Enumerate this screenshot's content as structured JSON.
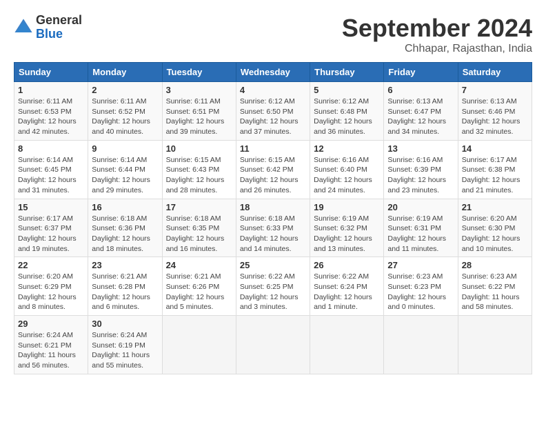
{
  "header": {
    "logo_general": "General",
    "logo_blue": "Blue",
    "month_title": "September 2024",
    "location": "Chhapar, Rajasthan, India"
  },
  "columns": [
    "Sunday",
    "Monday",
    "Tuesday",
    "Wednesday",
    "Thursday",
    "Friday",
    "Saturday"
  ],
  "weeks": [
    [
      {
        "day": "1",
        "info": "Sunrise: 6:11 AM\nSunset: 6:53 PM\nDaylight: 12 hours\nand 42 minutes."
      },
      {
        "day": "2",
        "info": "Sunrise: 6:11 AM\nSunset: 6:52 PM\nDaylight: 12 hours\nand 40 minutes."
      },
      {
        "day": "3",
        "info": "Sunrise: 6:11 AM\nSunset: 6:51 PM\nDaylight: 12 hours\nand 39 minutes."
      },
      {
        "day": "4",
        "info": "Sunrise: 6:12 AM\nSunset: 6:50 PM\nDaylight: 12 hours\nand 37 minutes."
      },
      {
        "day": "5",
        "info": "Sunrise: 6:12 AM\nSunset: 6:48 PM\nDaylight: 12 hours\nand 36 minutes."
      },
      {
        "day": "6",
        "info": "Sunrise: 6:13 AM\nSunset: 6:47 PM\nDaylight: 12 hours\nand 34 minutes."
      },
      {
        "day": "7",
        "info": "Sunrise: 6:13 AM\nSunset: 6:46 PM\nDaylight: 12 hours\nand 32 minutes."
      }
    ],
    [
      {
        "day": "8",
        "info": "Sunrise: 6:14 AM\nSunset: 6:45 PM\nDaylight: 12 hours\nand 31 minutes."
      },
      {
        "day": "9",
        "info": "Sunrise: 6:14 AM\nSunset: 6:44 PM\nDaylight: 12 hours\nand 29 minutes."
      },
      {
        "day": "10",
        "info": "Sunrise: 6:15 AM\nSunset: 6:43 PM\nDaylight: 12 hours\nand 28 minutes."
      },
      {
        "day": "11",
        "info": "Sunrise: 6:15 AM\nSunset: 6:42 PM\nDaylight: 12 hours\nand 26 minutes."
      },
      {
        "day": "12",
        "info": "Sunrise: 6:16 AM\nSunset: 6:40 PM\nDaylight: 12 hours\nand 24 minutes."
      },
      {
        "day": "13",
        "info": "Sunrise: 6:16 AM\nSunset: 6:39 PM\nDaylight: 12 hours\nand 23 minutes."
      },
      {
        "day": "14",
        "info": "Sunrise: 6:17 AM\nSunset: 6:38 PM\nDaylight: 12 hours\nand 21 minutes."
      }
    ],
    [
      {
        "day": "15",
        "info": "Sunrise: 6:17 AM\nSunset: 6:37 PM\nDaylight: 12 hours\nand 19 minutes."
      },
      {
        "day": "16",
        "info": "Sunrise: 6:18 AM\nSunset: 6:36 PM\nDaylight: 12 hours\nand 18 minutes."
      },
      {
        "day": "17",
        "info": "Sunrise: 6:18 AM\nSunset: 6:35 PM\nDaylight: 12 hours\nand 16 minutes."
      },
      {
        "day": "18",
        "info": "Sunrise: 6:18 AM\nSunset: 6:33 PM\nDaylight: 12 hours\nand 14 minutes."
      },
      {
        "day": "19",
        "info": "Sunrise: 6:19 AM\nSunset: 6:32 PM\nDaylight: 12 hours\nand 13 minutes."
      },
      {
        "day": "20",
        "info": "Sunrise: 6:19 AM\nSunset: 6:31 PM\nDaylight: 12 hours\nand 11 minutes."
      },
      {
        "day": "21",
        "info": "Sunrise: 6:20 AM\nSunset: 6:30 PM\nDaylight: 12 hours\nand 10 minutes."
      }
    ],
    [
      {
        "day": "22",
        "info": "Sunrise: 6:20 AM\nSunset: 6:29 PM\nDaylight: 12 hours\nand 8 minutes."
      },
      {
        "day": "23",
        "info": "Sunrise: 6:21 AM\nSunset: 6:28 PM\nDaylight: 12 hours\nand 6 minutes."
      },
      {
        "day": "24",
        "info": "Sunrise: 6:21 AM\nSunset: 6:26 PM\nDaylight: 12 hours\nand 5 minutes."
      },
      {
        "day": "25",
        "info": "Sunrise: 6:22 AM\nSunset: 6:25 PM\nDaylight: 12 hours\nand 3 minutes."
      },
      {
        "day": "26",
        "info": "Sunrise: 6:22 AM\nSunset: 6:24 PM\nDaylight: 12 hours\nand 1 minute."
      },
      {
        "day": "27",
        "info": "Sunrise: 6:23 AM\nSunset: 6:23 PM\nDaylight: 12 hours\nand 0 minutes."
      },
      {
        "day": "28",
        "info": "Sunrise: 6:23 AM\nSunset: 6:22 PM\nDaylight: 11 hours\nand 58 minutes."
      }
    ],
    [
      {
        "day": "29",
        "info": "Sunrise: 6:24 AM\nSunset: 6:21 PM\nDaylight: 11 hours\nand 56 minutes."
      },
      {
        "day": "30",
        "info": "Sunrise: 6:24 AM\nSunset: 6:19 PM\nDaylight: 11 hours\nand 55 minutes."
      },
      {
        "day": "",
        "info": ""
      },
      {
        "day": "",
        "info": ""
      },
      {
        "day": "",
        "info": ""
      },
      {
        "day": "",
        "info": ""
      },
      {
        "day": "",
        "info": ""
      }
    ]
  ]
}
